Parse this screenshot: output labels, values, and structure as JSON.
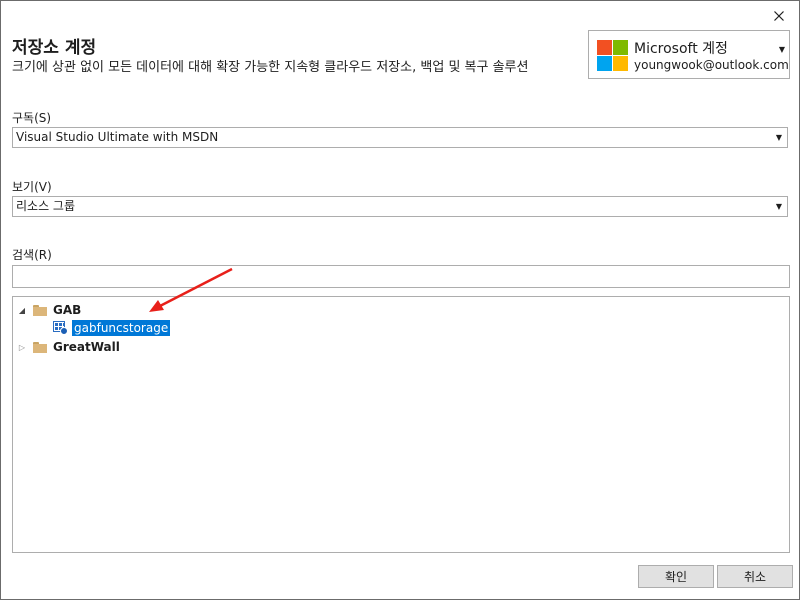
{
  "dialog": {
    "title": "저장소 계정",
    "subtitle": "크기에 상관 없이 모든 데이터에 대해 확장 가능한 지속형 클라우드 저장소, 백업 및 복구 솔루션",
    "close_glyph": "✕"
  },
  "account": {
    "name": "Microsoft 계정",
    "email": "youngwook@outlook.com",
    "logo_colors": [
      "#f25022",
      "#7fba00",
      "#00a4ef",
      "#ffb900"
    ]
  },
  "subscription": {
    "label": "구독(S)",
    "value": "Visual Studio Ultimate with MSDN"
  },
  "view": {
    "label": "보기(V)",
    "value": "리소스 그룹"
  },
  "search": {
    "label": "검색(R)",
    "value": "",
    "placeholder": ""
  },
  "tree": {
    "groups": [
      {
        "name": "GAB",
        "expanded": true,
        "children": [
          {
            "name": "gabfuncstorage",
            "selected": true,
            "icon": "storage-account-icon"
          }
        ]
      },
      {
        "name": "GreatWall",
        "expanded": false,
        "children": []
      }
    ]
  },
  "buttons": {
    "ok_label": "확인",
    "cancel_label": "취소"
  },
  "annotation": {
    "arrow_color": "#e8201a"
  },
  "colors": {
    "selection": "#0078d7",
    "border": "#adadad",
    "folder": "#dcb67a"
  }
}
